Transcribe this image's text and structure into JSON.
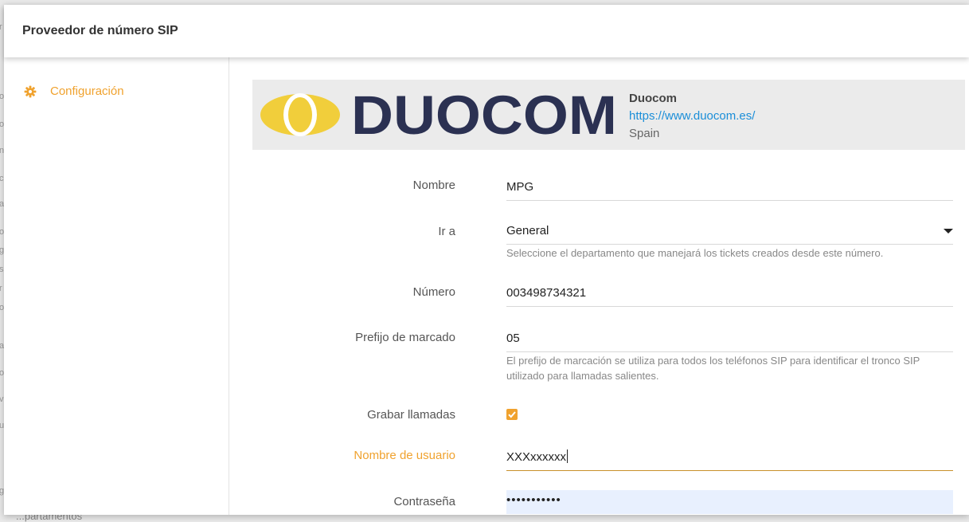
{
  "dialog": {
    "title": "Proveedor de número SIP"
  },
  "sidebar": {
    "items": [
      {
        "label": "Configuración",
        "icon": "gear-icon"
      }
    ]
  },
  "provider": {
    "logo_text": "DUOCOM",
    "name": "Duocom",
    "url": "https://www.duocom.es/",
    "country": "Spain"
  },
  "form": {
    "nombre": {
      "label": "Nombre",
      "value": "MPG"
    },
    "ir_a": {
      "label": "Ir a",
      "value": "General",
      "help": "Seleccione el departamento que manejará los tickets creados desde este número."
    },
    "numero": {
      "label": "Número",
      "value": "003498734321"
    },
    "prefijo": {
      "label": "Prefijo de marcado",
      "value": "05",
      "help_line1": "El prefijo de marcación se utiliza para todos los teléfonos SIP para identificar el tronco SIP",
      "help_line2": "utilizado para llamadas salientes."
    },
    "grabar": {
      "label": "Grabar llamadas",
      "checked": true
    },
    "usuario": {
      "label": "Nombre de usuario",
      "value": "XXXxxxxxx"
    },
    "contrasena": {
      "label": "Contraseña",
      "value": "•••••••••••"
    }
  },
  "background": {
    "bottom_text": "...partamentos"
  },
  "colors": {
    "accent": "#f0a22e",
    "link": "#1b8ed8",
    "logo_yellow": "#f1ce3b",
    "logo_navy": "#2b3152"
  }
}
